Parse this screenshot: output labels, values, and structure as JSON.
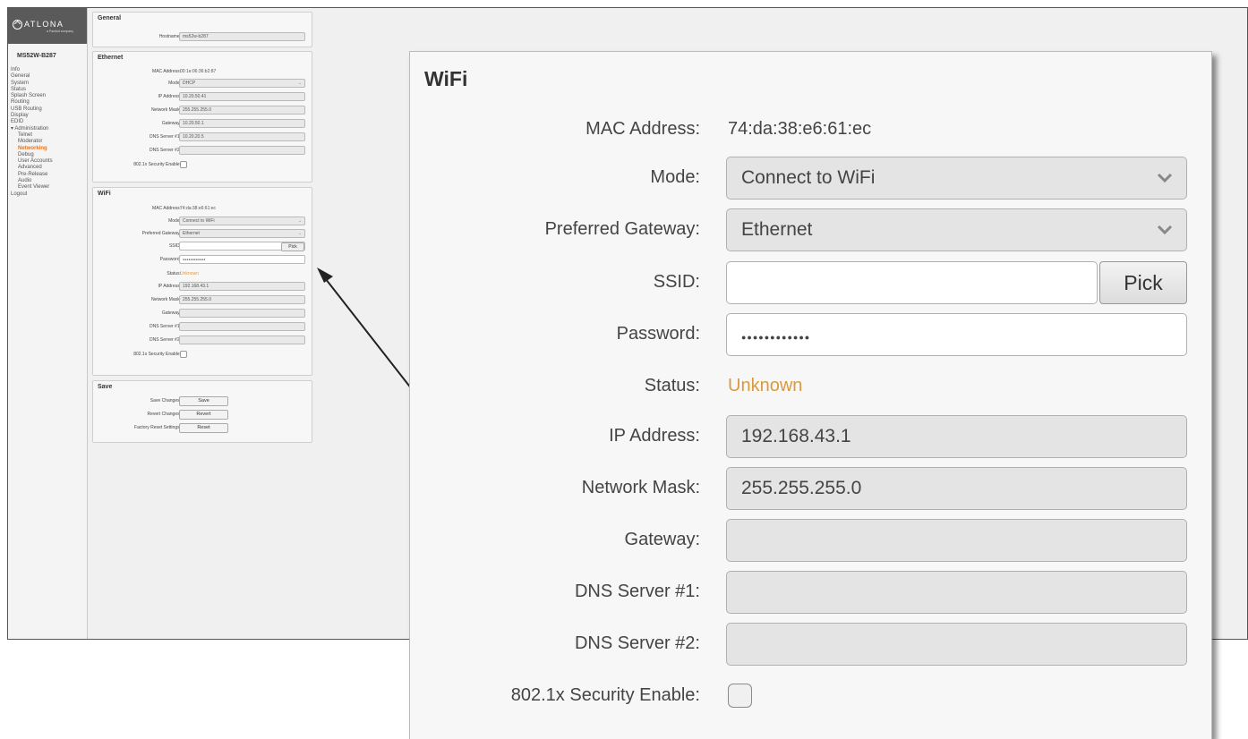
{
  "sidebar": {
    "logo_text": "ATLONA",
    "logo_sub": "a Panduit company",
    "device": "MS52W-B287",
    "items": [
      {
        "label": "Info",
        "sub": false,
        "active": false
      },
      {
        "label": "General",
        "sub": false,
        "active": false
      },
      {
        "label": "System",
        "sub": false,
        "active": false
      },
      {
        "label": "Status",
        "sub": false,
        "active": false
      },
      {
        "label": "Splash Screen",
        "sub": false,
        "active": false
      },
      {
        "label": "Routing",
        "sub": false,
        "active": false
      },
      {
        "label": "USB Routing",
        "sub": false,
        "active": false
      },
      {
        "label": "Display",
        "sub": false,
        "active": false
      },
      {
        "label": "EDID",
        "sub": false,
        "active": false
      },
      {
        "label": "▾ Administration",
        "sub": false,
        "active": false
      },
      {
        "label": "Telnet",
        "sub": true,
        "active": false
      },
      {
        "label": "Moderator",
        "sub": true,
        "active": false
      },
      {
        "label": "Networking",
        "sub": true,
        "active": true
      },
      {
        "label": "Debug",
        "sub": true,
        "active": false
      },
      {
        "label": "User Accounts",
        "sub": true,
        "active": false
      },
      {
        "label": "Advanced",
        "sub": true,
        "active": false
      },
      {
        "label": "Pre-Release",
        "sub": true,
        "active": false
      },
      {
        "label": "Audio",
        "sub": true,
        "active": false
      },
      {
        "label": "Event Viewer",
        "sub": true,
        "active": false
      },
      {
        "label": "Logout",
        "sub": false,
        "active": false
      }
    ]
  },
  "general": {
    "title": "General",
    "hostname_label": "Hostname:",
    "hostname_value": "ms52w-b287"
  },
  "ethernet": {
    "title": "Ethernet",
    "mac_label": "MAC Address:",
    "mac_value": "00:1e:06:36:b2:87",
    "mode_label": "Mode:",
    "mode_value": "DHCP",
    "ip_label": "IP Address:",
    "ip_value": "10.20.50.41",
    "mask_label": "Network Mask:",
    "mask_value": "255.255.255.0",
    "gateway_label": "Gateway:",
    "gateway_value": "10.20.50.1",
    "dns1_label": "DNS Server #1:",
    "dns1_value": "10.20.20.5",
    "dns2_label": "DNS Server #2:",
    "dns2_value": "",
    "security_label": "802.1x Security Enable:"
  },
  "wifi": {
    "title": "WiFi",
    "mac_label": "MAC Address:",
    "mac_value": "74:da:38:e6:61:ec",
    "mode_label": "Mode:",
    "mode_value": "Connect to WiFi",
    "gw_pref_label": "Preferred Gateway:",
    "gw_pref_value": "Ethernet",
    "ssid_label": "SSID:",
    "ssid_value": "",
    "pick_label": "Pick",
    "password_label": "Password:",
    "password_value": "●●●●●●●●●●●●",
    "status_label": "Status:",
    "status_value": "Unknown",
    "ip_label": "IP Address:",
    "ip_value": "192.168.43.1",
    "mask_label": "Network Mask:",
    "mask_value": "255.255.255.0",
    "gateway_label": "Gateway:",
    "gateway_value": "",
    "dns1_label": "DNS Server #1:",
    "dns1_value": "",
    "dns2_label": "DNS Server #2:",
    "dns2_value": "",
    "security_label": "802.1x Security Enable:"
  },
  "save": {
    "title": "Save",
    "save_label": "Save Changes:",
    "save_button": "Save",
    "revert_label": "Revert Changes:",
    "revert_button": "Revert",
    "reset_label": "Factory Reset Settings:",
    "reset_button": "Reset"
  },
  "colors": {
    "status_unknown": "#d99a3f",
    "nav_active": "#e8731a",
    "logo_bar": "#5a5a5a"
  }
}
